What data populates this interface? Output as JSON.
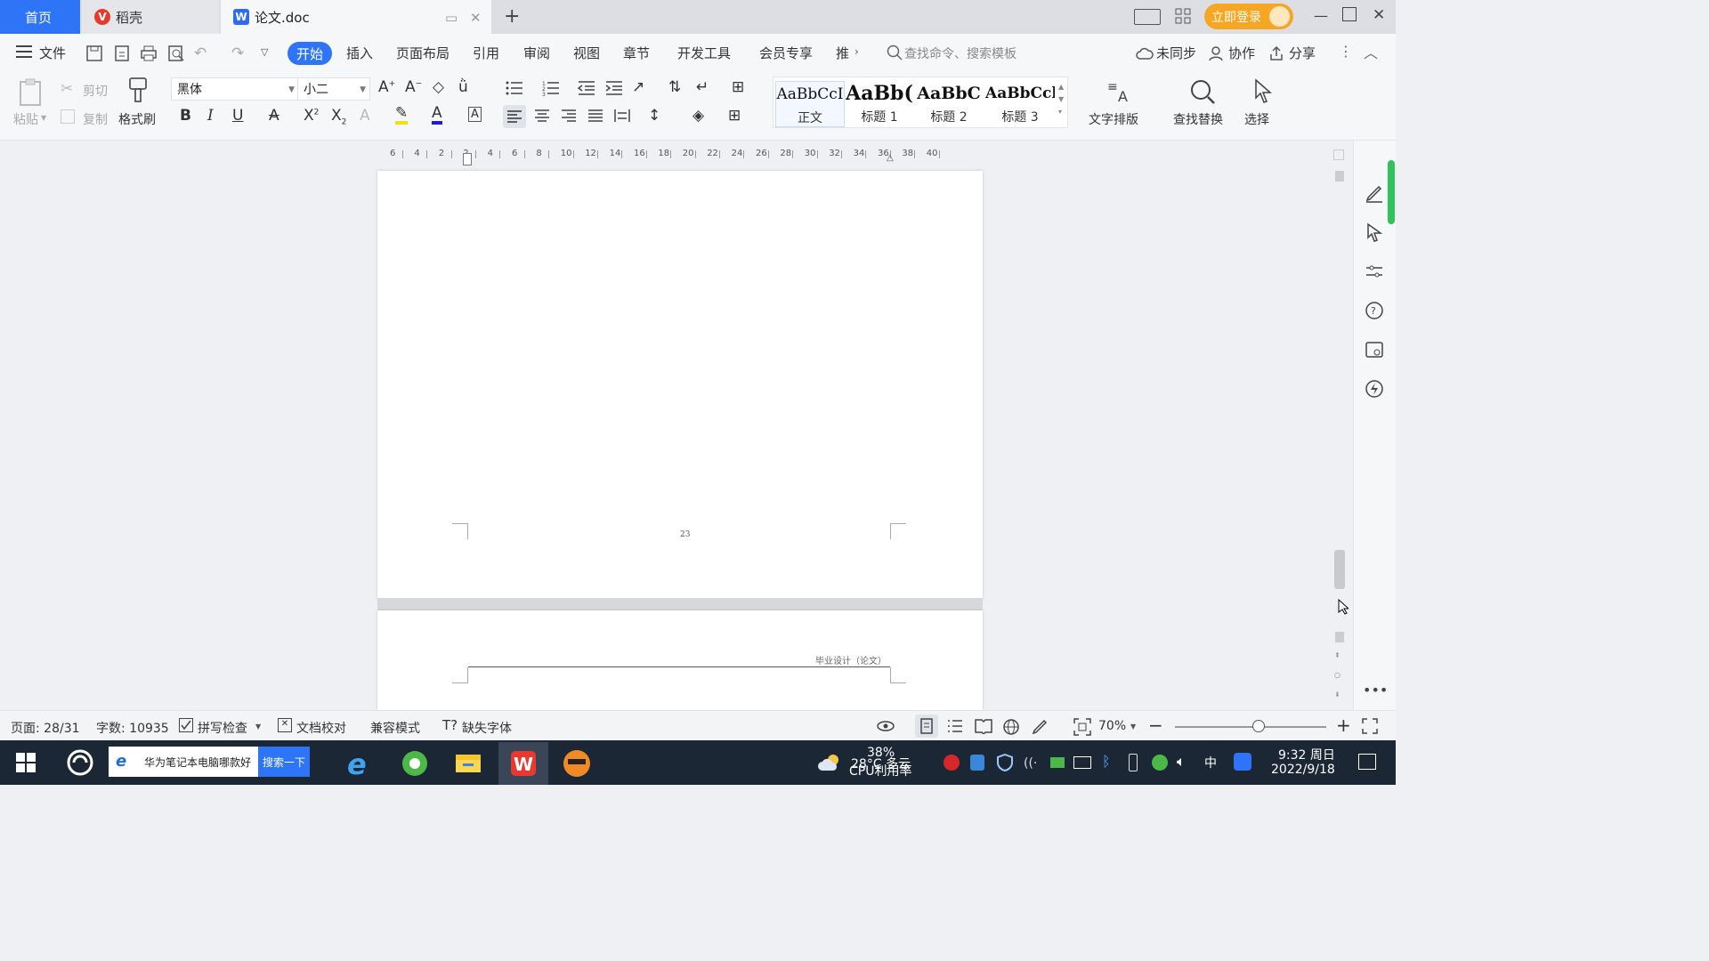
{
  "tabs": {
    "home": "首页",
    "daoke": "稻壳",
    "doc": "论文.doc",
    "new_tab": "+"
  },
  "title_actions": {
    "login": "立即登录"
  },
  "menu": {
    "file": "文件",
    "items": [
      "开始",
      "插入",
      "页面布局",
      "引用",
      "审阅",
      "视图",
      "章节",
      "开发工具",
      "会员专享",
      "推"
    ],
    "search_placeholder": "查找命令、搜索模板",
    "sync": "未同步",
    "collab": "协作",
    "share": "分享"
  },
  "ribbon": {
    "paste": "粘贴",
    "cut": "剪切",
    "copy": "复制",
    "format_painter": "格式刷",
    "font_name": "黑体",
    "font_size": "小二",
    "styles": [
      {
        "preview": "AaBbCcI",
        "name": "正文"
      },
      {
        "preview": "AaBb(",
        "name": "标题 1"
      },
      {
        "preview": "AaBbC",
        "name": "标题 2"
      },
      {
        "preview": "AaBbCcl",
        "name": "标题 3"
      }
    ],
    "text_layout": "文字排版",
    "find_replace": "查找替换",
    "select": "选择"
  },
  "ruler_ticks": [
    "6",
    "4",
    "2",
    "2",
    "4",
    "6",
    "8",
    "10",
    "12",
    "14",
    "16",
    "18",
    "20",
    "22",
    "24",
    "26",
    "28",
    "30",
    "32",
    "34",
    "36",
    "38",
    "40"
  ],
  "document": {
    "page_number": "23",
    "next_page_header": "毕业设计（论文）"
  },
  "status": {
    "page": "页面: 28/31",
    "words": "字数: 10935",
    "spell_check": "拼写检查",
    "doc_proof": "文档校对",
    "compat_mode": "兼容模式",
    "missing_font": "缺失字体",
    "zoom": "70%",
    "zoom_fraction": 0.55
  },
  "taskbar": {
    "search_text": "华为笔记本电脑哪款好",
    "search_button": "搜索一下",
    "weather": "28°C 多云",
    "cpu_percent": "38%",
    "cpu_label": "CPU利用率",
    "ime": "中",
    "time": "9:32 周日",
    "date": "2022/9/18"
  },
  "colors": {
    "accent": "#2e74f6",
    "login": "#f5a623",
    "wps_red": "#e8392f"
  }
}
